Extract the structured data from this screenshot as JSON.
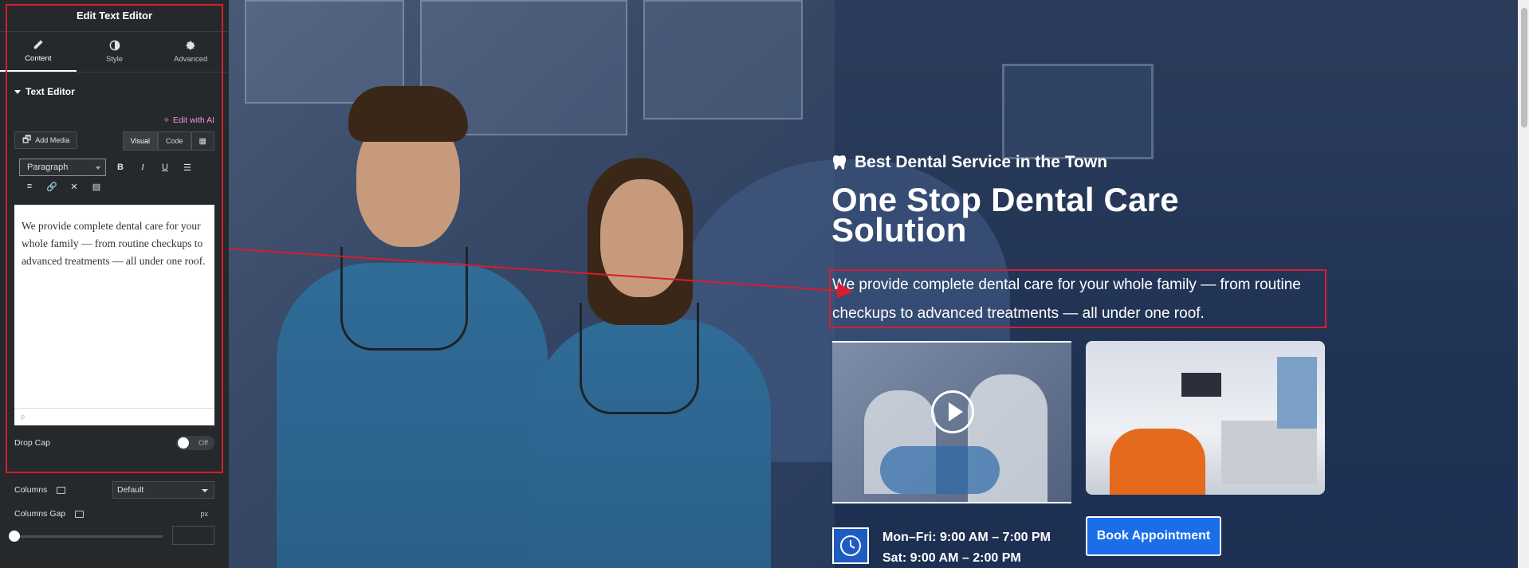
{
  "panel": {
    "title": "Edit Text Editor",
    "tabs": [
      {
        "label": "Content",
        "icon": "pencil-icon"
      },
      {
        "label": "Style",
        "icon": "half-circle-icon"
      },
      {
        "label": "Advanced",
        "icon": "gear-icon"
      }
    ],
    "section": "Text Editor",
    "edit_ai": "Edit with AI",
    "add_media": "Add Media",
    "mode_tabs": [
      "Visual",
      "Code"
    ],
    "format_select": "Paragraph",
    "editor_content": "We provide complete dental care for your whole family — from routine checkups to advanced treatments — all under one roof.",
    "editor_footer": "p",
    "drop_cap": {
      "label": "Drop Cap",
      "state": "Off"
    },
    "columns": {
      "label": "Columns",
      "value": "Default"
    },
    "columns_gap": {
      "label": "Columns Gap",
      "unit": "px"
    }
  },
  "preview": {
    "eyebrow": "Best Dental Service in the Town",
    "headline": "One Stop Dental Care Solution",
    "description": "We provide complete dental care for your whole family — from routine checkups to advanced treatments — all under one roof.",
    "hours": [
      "Mon–Fri: 9:00 AM – 7:00 PM",
      "Sat: 9:00 AM – 2:00 PM"
    ],
    "cta": "Book Appointment"
  },
  "colors": {
    "panel_bg": "#26292c",
    "highlight": "#d71d2e",
    "ai_accent": "#f095e0",
    "cta_blue": "#1a6fe8"
  }
}
